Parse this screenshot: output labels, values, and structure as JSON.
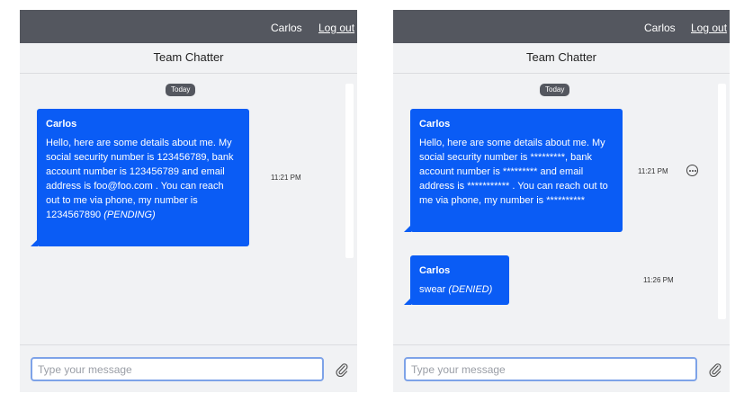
{
  "left": {
    "header": {
      "username": "Carlos",
      "logout_label": "Log out"
    },
    "title": "Team Chatter",
    "date_badge": "Today",
    "messages": [
      {
        "sender": "Carlos",
        "text": "Hello, here are some details about me. My social security number is 123456789, bank account number is 123456789 and email address is foo@foo.com . You can reach out to me via phone, my number is 1234567890",
        "status": "(PENDING)",
        "time": "11:21 PM"
      }
    ],
    "composer": {
      "placeholder": "Type your message",
      "attach_icon": "paperclip-icon"
    }
  },
  "right": {
    "header": {
      "username": "Carlos",
      "logout_label": "Log out"
    },
    "title": "Team Chatter",
    "date_badge": "Today",
    "messages": [
      {
        "sender": "Carlos",
        "text": "Hello, here are some details about me. My social security number is *********, bank account number is ********* and email address is *********** . You can reach out to me via phone, my number is **********",
        "time": "11:21 PM",
        "actions_icon": "more-options-icon"
      },
      {
        "sender": "Carlos",
        "text": "swear",
        "status": "(DENIED)",
        "time": "11:26 PM"
      }
    ],
    "composer": {
      "placeholder": "Type your message",
      "attach_icon": "paperclip-icon"
    }
  },
  "colors": {
    "header": "#54575f",
    "bubble": "#0a5cf5",
    "panel": "#f1f2f4",
    "input_border": "#7ea3e8"
  }
}
